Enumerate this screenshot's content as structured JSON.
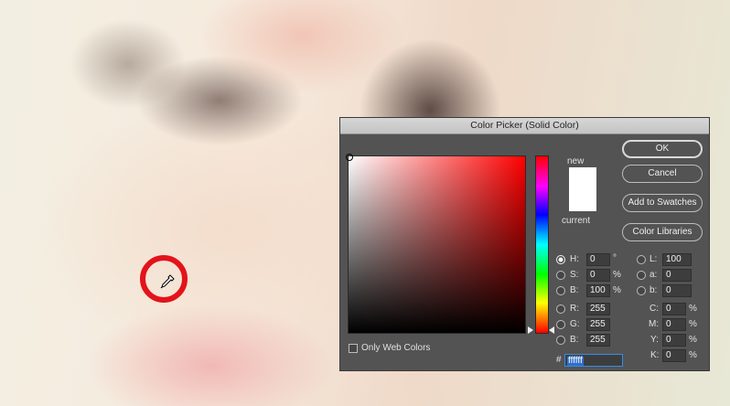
{
  "dialog": {
    "title": "Color Picker (Solid Color)",
    "new_label": "new",
    "current_label": "current",
    "new_color": "#ffffff",
    "current_color": "#ffffff",
    "only_web_colors_label": "Only Web Colors",
    "only_web_colors_checked": false,
    "buttons": {
      "ok": "OK",
      "cancel": "Cancel",
      "add_to_swatches": "Add to Swatches",
      "color_libraries": "Color Libraries"
    },
    "hsb": {
      "h_label": "H:",
      "h_value": "0",
      "h_unit": "°",
      "s_label": "S:",
      "s_value": "0",
      "s_unit": "%",
      "b_label": "B:",
      "b_value": "100",
      "b_unit": "%",
      "selected": "H"
    },
    "rgb": {
      "r_label": "R:",
      "r_value": "255",
      "g_label": "G:",
      "g_value": "255",
      "b_label": "B:",
      "b_value": "255"
    },
    "lab": {
      "l_label": "L:",
      "l_value": "100",
      "a_label": "a:",
      "a_value": "0",
      "b_label": "b:",
      "b_value": "0"
    },
    "cmyk": {
      "c_label": "C:",
      "c_value": "0",
      "c_unit": "%",
      "m_label": "M:",
      "m_value": "0",
      "m_unit": "%",
      "y_label": "Y:",
      "y_value": "0",
      "y_unit": "%",
      "k_label": "K:",
      "k_value": "0",
      "k_unit": "%"
    },
    "hex": {
      "hash": "#",
      "value": "ffffff"
    }
  },
  "icons": {
    "eyedropper": "eyedropper-icon",
    "highlight_ring": "red-circle-highlight"
  },
  "colors": {
    "highlight": "#e3131a",
    "dialog_bg": "#535353"
  }
}
